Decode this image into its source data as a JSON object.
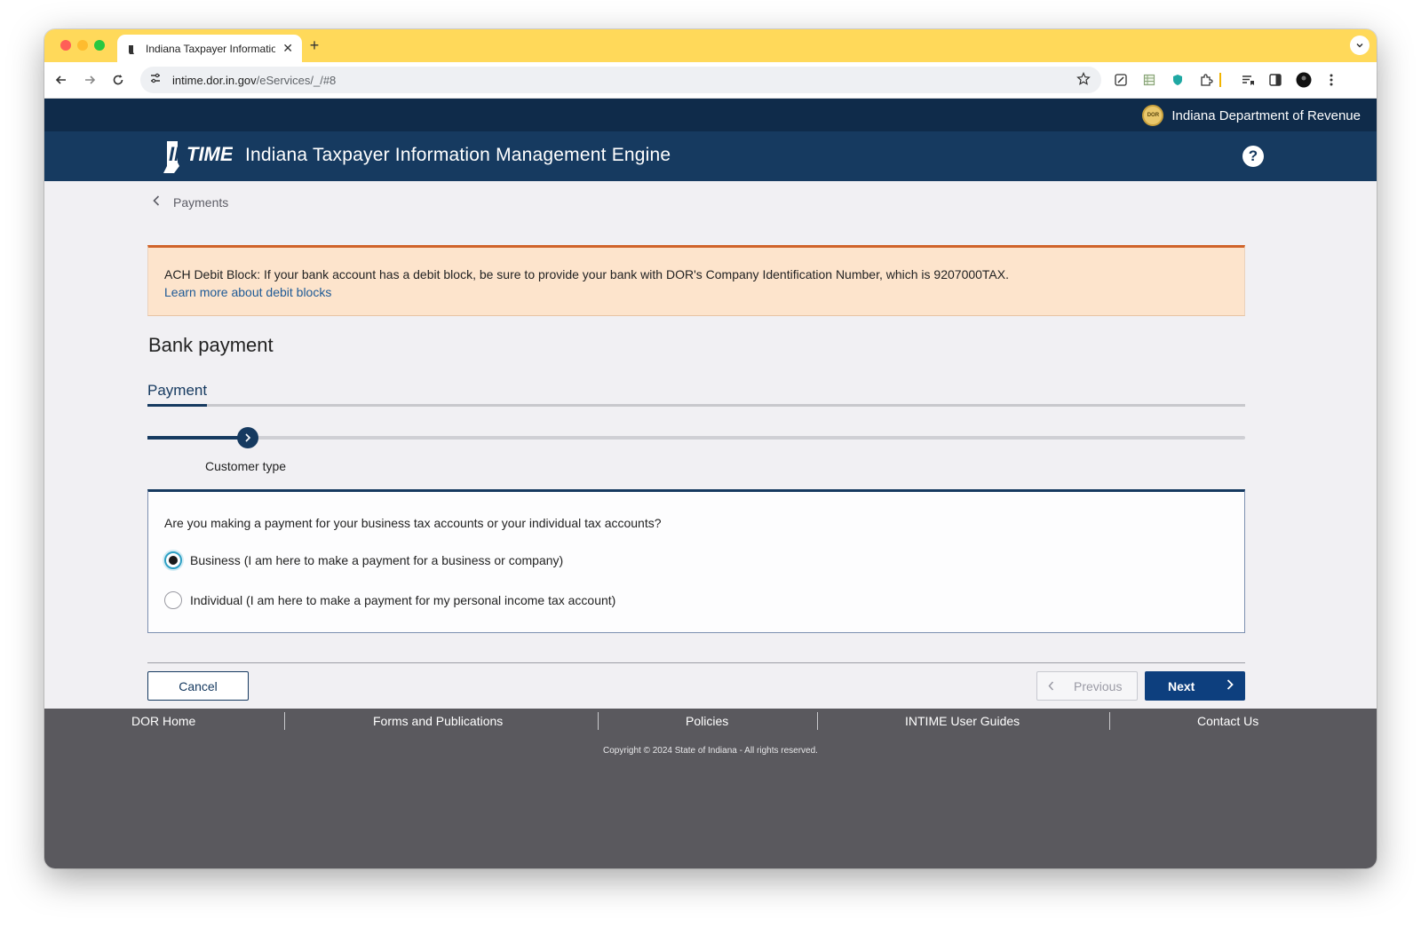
{
  "browser": {
    "tab_title": "Indiana Taxpayer Information",
    "url_host": "intime.dor.in.gov",
    "url_path": "/eServices/_/#8"
  },
  "site": {
    "agency_name": "Indiana Department of Revenue",
    "seal_text": "DOR",
    "logo_text": "INTIME",
    "app_title": "Indiana Taxpayer Information Management Engine",
    "help_symbol": "?"
  },
  "breadcrumb": {
    "back_label": "Payments"
  },
  "alert": {
    "message": "ACH Debit Block: If your bank account has a debit block, be sure to provide your bank with DOR's Company Identification Number, which is 9207000TAX.",
    "link_text": "Learn more about debit blocks"
  },
  "page": {
    "heading": "Bank payment",
    "tab_label": "Payment",
    "step_label": "Customer type",
    "question": "Are you making a payment for your business tax accounts or your individual tax accounts?",
    "options": [
      {
        "label": "Business (I am here to make a payment for a business or company)",
        "selected": true
      },
      {
        "label": "Individual (I am here to make a payment for my personal income tax account)",
        "selected": false
      }
    ]
  },
  "actions": {
    "cancel": "Cancel",
    "previous": "Previous",
    "next": "Next"
  },
  "footer": {
    "links": [
      "DOR Home",
      "Forms and Publications",
      "Policies",
      "INTIME User Guides",
      "Contact Us"
    ],
    "copyright": "Copyright © 2024 State of Indiana - All rights reserved."
  },
  "colors": {
    "tab_strip": "#ffd95a",
    "header_dark": "#0f2b4a",
    "header_blue": "#163a60",
    "alert_bg": "#fde4cc",
    "alert_border": "#d0642a",
    "primary_button": "#0d3f7e",
    "footer_bg": "#5a595e"
  }
}
